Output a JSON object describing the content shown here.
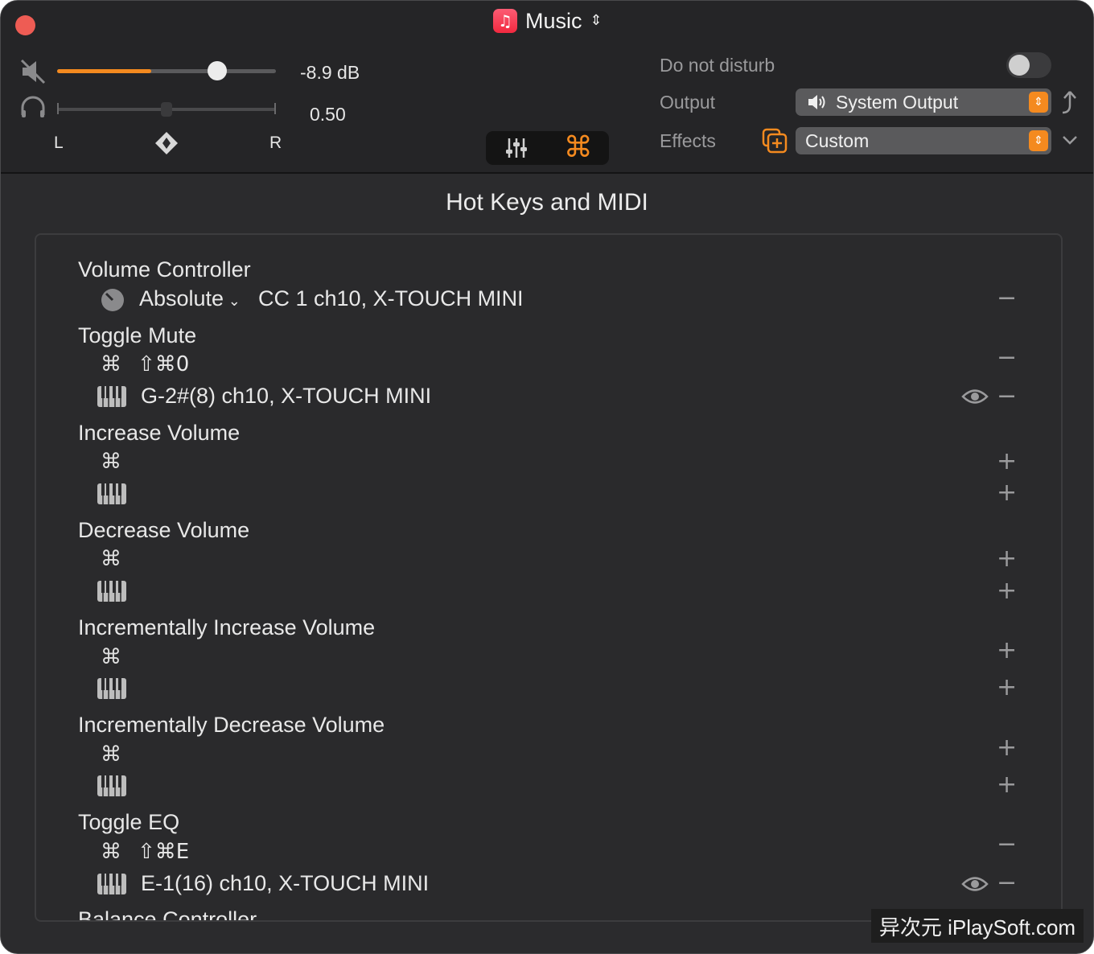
{
  "titlebar": {
    "app_name": "Music",
    "chevron": "⌃⌄",
    "icon": "music-note-icon"
  },
  "volume": {
    "db_text": "-8.9 dB",
    "level": 0.43,
    "knob_fraction": 0.73
  },
  "balance": {
    "value_text": "0.50",
    "left_label": "L",
    "right_label": "R"
  },
  "controls": {
    "dnd_label": "Do not disturb",
    "dnd_on": false,
    "output_label": "Output",
    "output_value": "System Output",
    "effects_label": "Effects",
    "effects_value": "Custom"
  },
  "accent_color": "#f48a1f",
  "panel": {
    "title": "Hot Keys and MIDI",
    "items": [
      {
        "title": "Volume Controller",
        "sub1_mode": "Absolute",
        "sub1_text": "CC 1 ch10, X-TOUCH MINI",
        "sub1_action": "−"
      },
      {
        "title": "Toggle Mute",
        "hotkey": "⇧⌘0",
        "hotkey_action": "−",
        "midi": "G-2#(8) ch10, X-TOUCH MINI",
        "midi_action": "−"
      },
      {
        "title": "Increase Volume",
        "hotkey_action": "+",
        "midi_action": "+"
      },
      {
        "title": "Decrease Volume",
        "hotkey_action": "+",
        "midi_action": "+"
      },
      {
        "title": "Incrementally Increase Volume",
        "hotkey_action": "+",
        "midi_action": "+"
      },
      {
        "title": "Incrementally Decrease Volume",
        "hotkey_action": "+",
        "midi_action": "+"
      },
      {
        "title": "Toggle EQ",
        "hotkey": "⇧⌘E",
        "hotkey_action": "−",
        "midi": "E-1(16) ch10, X-TOUCH MINI",
        "midi_action": "−"
      },
      {
        "title": "Balance Controller"
      }
    ]
  },
  "glyphs": {
    "command": "⌘",
    "chevron_small": "⌄"
  },
  "watermark": "异次元 iPlaySoft.com"
}
